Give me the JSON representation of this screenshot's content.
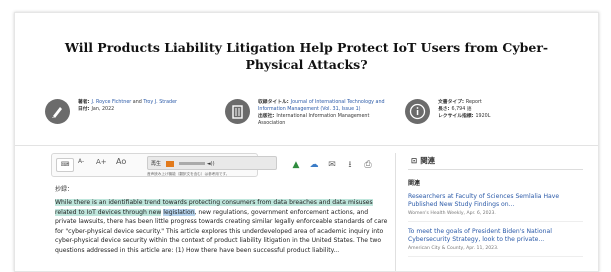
{
  "title": "Will Products Liability Litigation Help Protect IoT Users from Cyber-Physical Attacks?",
  "author_block": {
    "author_key": "著者:",
    "author1": "J. Royce Fichtner",
    "and": "and",
    "author2": "Troy J. Strader",
    "date_key": "日付:",
    "date": "Jan, 2022"
  },
  "source_block": {
    "pub_key": "収録タイトル:",
    "pub": "Journal of International Technology and Information Management (Vol. 31, Issue 1)",
    "publisher_key": "出版社:",
    "publisher": "International Information Management Association"
  },
  "doc_block": {
    "type_key": "文書タイプ:",
    "type": "Report",
    "length_key": "長さ:",
    "length": "6,794 語",
    "lexile_key": "レクサイル指標:",
    "lexile": "1920L"
  },
  "toolbar": {
    "a_minus": "A-",
    "a_plus": "A+",
    "a_reset": "Ao",
    "speech_label": "再生",
    "speech_note": "音声読み上げ機能（翻訳文を含む）は参考用です。"
  },
  "abstract_label": "抄録：",
  "abstract": {
    "hl_text": "While there is an identifiable trend towards protecting consumers from data breaches and data misuses related to IoT devices through new",
    "hl2_text": "legislation",
    "rest": ", new regulations, government enforcement actions, and private lawsuits, there has been little progress towards creating similar legally enforceable standards of care for \"cyber-physical device security.\" This article explores this underdeveloped area of academic inquiry into cyber-physical device security within the context of product liability litigation in the United States. The two questions addressed in this article are: (1) How there have been successful product liability..."
  },
  "sidebar": {
    "header": "関連",
    "sub": "関連",
    "items": [
      {
        "title": "Researchers at Faculty of Sciences Semlalia Have Published New Study Findings on...",
        "source": "Women's Health Weekly, Apr. 6, 2023."
      },
      {
        "title": "To meet the goals of President Biden's National Cybersecurity Strategy, look to the private...",
        "source": "American City & County, Apr. 11, 2023."
      }
    ]
  },
  "colors": {
    "highlight": "#bfe6dc",
    "highlight2": "#b6d4ee",
    "link": "#2b5aa8",
    "icon_bg": "#6b6b6b"
  }
}
